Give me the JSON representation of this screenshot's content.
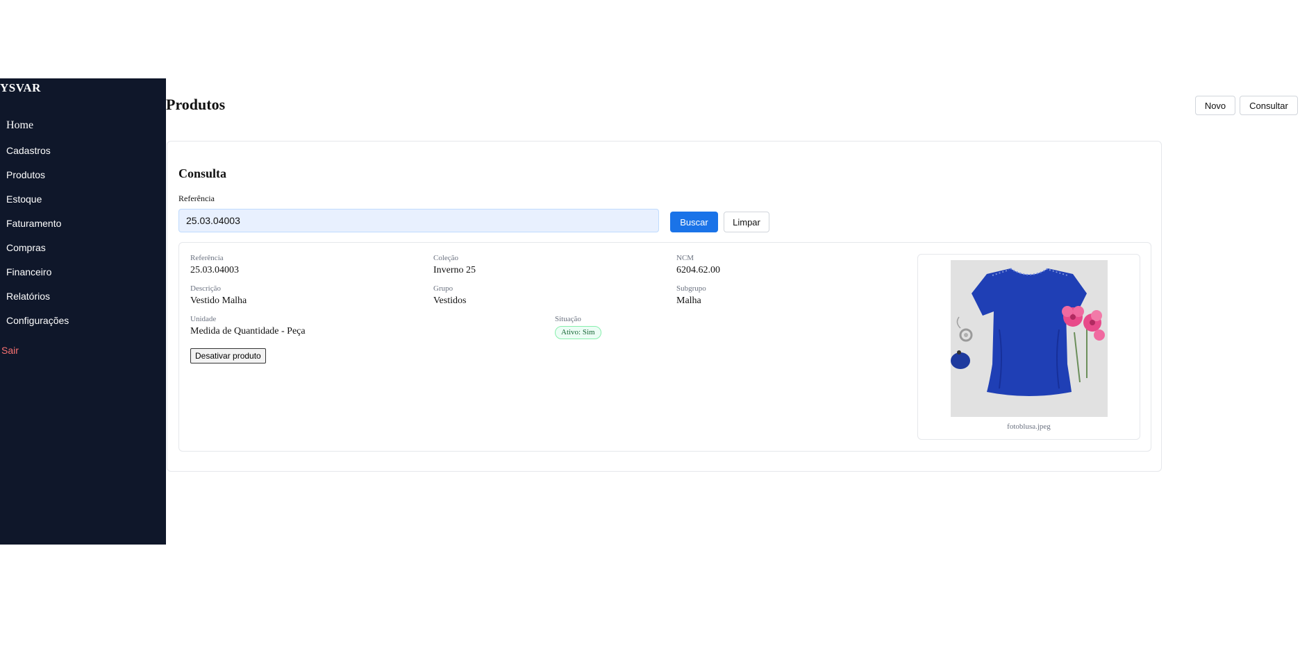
{
  "sidebar": {
    "brand": "YSVAR",
    "items": [
      {
        "label": "Home"
      },
      {
        "label": "Cadastros"
      },
      {
        "label": "Produtos"
      },
      {
        "label": "Estoque"
      },
      {
        "label": "Faturamento"
      },
      {
        "label": "Compras"
      },
      {
        "label": "Financeiro"
      },
      {
        "label": "Relatórios"
      },
      {
        "label": "Configurações"
      }
    ],
    "logout_label": "Sair",
    "logout_color": "#f87171",
    "background_color": "#0f172a"
  },
  "header": {
    "title": "Produtos",
    "new_label": "Novo",
    "query_label": "Consultar"
  },
  "consulta": {
    "title": "Consulta",
    "field_label": "Referência",
    "field_value": "25.03.04003",
    "search_label": "Buscar",
    "clear_label": "Limpar",
    "primary_color": "#1a73e8"
  },
  "product": {
    "fields": {
      "referencia": {
        "label": "Referência",
        "value": "25.03.04003"
      },
      "colecao": {
        "label": "Coleção",
        "value": "Inverno 25"
      },
      "ncm": {
        "label": "NCM",
        "value": "6204.62.00"
      },
      "descricao": {
        "label": "Descrição",
        "value": "Vestido Malha"
      },
      "grupo": {
        "label": "Grupo",
        "value": "Vestidos"
      },
      "subgrupo": {
        "label": "Subgrupo",
        "value": "Malha"
      },
      "unidade": {
        "label": "Unidade",
        "value": "Medida de Quantidade - Peça"
      },
      "situacao": {
        "label": "Situação",
        "value": "Ativo: Sim"
      }
    },
    "deactivate_label": "Desativar produto",
    "image": {
      "filename": "fotoblusa.jpeg",
      "description": "blue-short-sleeve-blouse-photo",
      "garment_color": "#1f3fb5"
    }
  }
}
